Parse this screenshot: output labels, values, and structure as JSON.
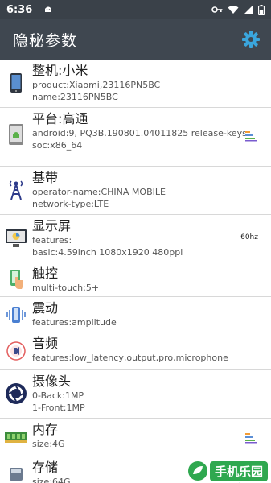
{
  "status": {
    "time": "6:36"
  },
  "appbar": {
    "title": "隐秘参数"
  },
  "rows": [
    {
      "name": "整机:小米",
      "lines": [
        "product:Xiaomi,23116PN5BC",
        "name:23116PN5BC"
      ]
    },
    {
      "name": "平台:高通",
      "lines": [
        "android:9, PQ3B.190801.04011825 release-keys",
        "soc:x86_64"
      ]
    },
    {
      "name": "基带",
      "lines": [
        "operator-name:CHINA MOBILE",
        "network-type:LTE"
      ]
    },
    {
      "name": "显示屏",
      "right": "60hz",
      "lines": [
        "features:",
        "basic:4.59inch 1080x1920 480ppi"
      ]
    },
    {
      "name": "触控",
      "lines": [
        "multi-touch:5+"
      ]
    },
    {
      "name": "震动",
      "lines": [
        "features:amplitude"
      ]
    },
    {
      "name": "音频",
      "lines": [
        "features:low_latency,output,pro,microphone"
      ]
    },
    {
      "name": "摄像头",
      "lines": [
        "0-Back:1MP",
        "1-Front:1MP"
      ]
    },
    {
      "name": "内存",
      "lines": [
        "size:4G"
      ]
    },
    {
      "name": "存储",
      "lines": [
        "size:64G"
      ]
    }
  ],
  "watermark": {
    "text": "手机乐园",
    "sub": "www.shouji.com.cn"
  },
  "colors": {
    "statusbar": "#3a4149",
    "appbar": "#3f4750",
    "accent": "#3aa6dd",
    "divider": "#d8d8d8"
  }
}
